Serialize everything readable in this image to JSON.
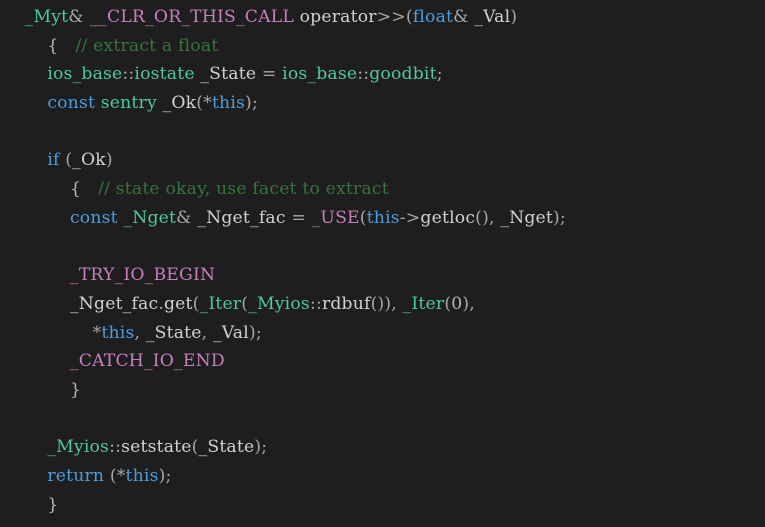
{
  "editor": {
    "background_color": "#1e1e1e",
    "language": "C++",
    "font_size_px": 17,
    "line_height_px": 28.7,
    "indent_unit": "    "
  },
  "palette": {
    "plain": "#cfcfcf",
    "punctuation": "#a8a8a8",
    "keyword": "#4a9ee0",
    "type": "#4ec9a0",
    "macro": "#c77fc0",
    "comment": "#37753a",
    "identifier": "#d2d2d2",
    "number": "#b6b6b6",
    "brace": "#b9b9a8"
  },
  "code": {
    "lines": [
      {
        "indent": "    ",
        "tokens": [
          {
            "text": "_Myt",
            "kind": "type"
          },
          {
            "text": "& ",
            "kind": "punct"
          },
          {
            "text": "__CLR_OR_THIS_CALL",
            "kind": "macro"
          },
          {
            "text": " ",
            "kind": "plain"
          },
          {
            "text": "operator",
            "kind": "ident"
          },
          {
            "text": ">>",
            "kind": "punct"
          },
          {
            "text": "(",
            "kind": "punct"
          },
          {
            "text": "float",
            "kind": "keyword"
          },
          {
            "text": "& ",
            "kind": "punct"
          },
          {
            "text": "_Val",
            "kind": "ident"
          },
          {
            "text": ")",
            "kind": "punct"
          }
        ]
      },
      {
        "indent": "        ",
        "tokens": [
          {
            "text": "{",
            "kind": "brace"
          },
          {
            "text": "   ",
            "kind": "plain"
          },
          {
            "text": "// extract a float",
            "kind": "comment"
          }
        ]
      },
      {
        "indent": "        ",
        "tokens": [
          {
            "text": "ios_base",
            "kind": "type"
          },
          {
            "text": "::",
            "kind": "punct"
          },
          {
            "text": "iostate",
            "kind": "type"
          },
          {
            "text": " ",
            "kind": "plain"
          },
          {
            "text": "_State",
            "kind": "ident"
          },
          {
            "text": " = ",
            "kind": "punct"
          },
          {
            "text": "ios_base",
            "kind": "type"
          },
          {
            "text": "::",
            "kind": "punct"
          },
          {
            "text": "goodbit",
            "kind": "type"
          },
          {
            "text": ";",
            "kind": "punct"
          }
        ]
      },
      {
        "indent": "        ",
        "tokens": [
          {
            "text": "const",
            "kind": "keyword"
          },
          {
            "text": " ",
            "kind": "plain"
          },
          {
            "text": "sentry",
            "kind": "type"
          },
          {
            "text": " ",
            "kind": "plain"
          },
          {
            "text": "_Ok",
            "kind": "ident"
          },
          {
            "text": "(",
            "kind": "punct"
          },
          {
            "text": "*",
            "kind": "punct"
          },
          {
            "text": "this",
            "kind": "keyword"
          },
          {
            "text": ");",
            "kind": "punct"
          }
        ]
      },
      {
        "indent": "",
        "tokens": []
      },
      {
        "indent": "        ",
        "tokens": [
          {
            "text": "if",
            "kind": "keyword"
          },
          {
            "text": " (",
            "kind": "punct"
          },
          {
            "text": "_Ok",
            "kind": "ident"
          },
          {
            "text": ")",
            "kind": "punct"
          }
        ]
      },
      {
        "indent": "            ",
        "tokens": [
          {
            "text": "{",
            "kind": "brace"
          },
          {
            "text": "   ",
            "kind": "plain"
          },
          {
            "text": "// state okay, use facet to extract",
            "kind": "comment"
          }
        ]
      },
      {
        "indent": "            ",
        "tokens": [
          {
            "text": "const",
            "kind": "keyword"
          },
          {
            "text": " ",
            "kind": "plain"
          },
          {
            "text": "_Nget",
            "kind": "type"
          },
          {
            "text": "& ",
            "kind": "punct"
          },
          {
            "text": "_Nget_fac",
            "kind": "ident"
          },
          {
            "text": " = ",
            "kind": "punct"
          },
          {
            "text": "_USE",
            "kind": "macro"
          },
          {
            "text": "(",
            "kind": "punct"
          },
          {
            "text": "this",
            "kind": "keyword"
          },
          {
            "text": "->",
            "kind": "punct"
          },
          {
            "text": "getloc",
            "kind": "ident"
          },
          {
            "text": "(), ",
            "kind": "punct"
          },
          {
            "text": "_Nget",
            "kind": "ident"
          },
          {
            "text": ");",
            "kind": "punct"
          }
        ]
      },
      {
        "indent": "",
        "tokens": []
      },
      {
        "indent": "            ",
        "tokens": [
          {
            "text": "_TRY_IO_BEGIN",
            "kind": "macro"
          }
        ]
      },
      {
        "indent": "            ",
        "tokens": [
          {
            "text": "_Nget_fac",
            "kind": "ident"
          },
          {
            "text": ".",
            "kind": "punct"
          },
          {
            "text": "get",
            "kind": "ident"
          },
          {
            "text": "(",
            "kind": "punct"
          },
          {
            "text": "_Iter",
            "kind": "type"
          },
          {
            "text": "(",
            "kind": "punct"
          },
          {
            "text": "_Myios",
            "kind": "type"
          },
          {
            "text": "::",
            "kind": "punct"
          },
          {
            "text": "rdbuf",
            "kind": "ident"
          },
          {
            "text": "()), ",
            "kind": "punct"
          },
          {
            "text": "_Iter",
            "kind": "type"
          },
          {
            "text": "(",
            "kind": "punct"
          },
          {
            "text": "0",
            "kind": "number"
          },
          {
            "text": "),",
            "kind": "punct"
          }
        ]
      },
      {
        "indent": "                ",
        "tokens": [
          {
            "text": "*",
            "kind": "punct"
          },
          {
            "text": "this",
            "kind": "keyword"
          },
          {
            "text": ", ",
            "kind": "punct"
          },
          {
            "text": "_State",
            "kind": "ident"
          },
          {
            "text": ", ",
            "kind": "punct"
          },
          {
            "text": "_Val",
            "kind": "ident"
          },
          {
            "text": ");",
            "kind": "punct"
          }
        ]
      },
      {
        "indent": "            ",
        "tokens": [
          {
            "text": "_CATCH_IO_END",
            "kind": "macro"
          }
        ]
      },
      {
        "indent": "            ",
        "tokens": [
          {
            "text": "}",
            "kind": "brace"
          }
        ]
      },
      {
        "indent": "",
        "tokens": []
      },
      {
        "indent": "        ",
        "tokens": [
          {
            "text": "_Myios",
            "kind": "type"
          },
          {
            "text": "::",
            "kind": "punct"
          },
          {
            "text": "setstate",
            "kind": "ident"
          },
          {
            "text": "(",
            "kind": "punct"
          },
          {
            "text": "_State",
            "kind": "ident"
          },
          {
            "text": ");",
            "kind": "punct"
          }
        ]
      },
      {
        "indent": "        ",
        "tokens": [
          {
            "text": "return",
            "kind": "keyword"
          },
          {
            "text": " (",
            "kind": "punct"
          },
          {
            "text": "*",
            "kind": "punct"
          },
          {
            "text": "this",
            "kind": "keyword"
          },
          {
            "text": ");",
            "kind": "punct"
          }
        ]
      },
      {
        "indent": "        ",
        "tokens": [
          {
            "text": "}",
            "kind": "brace"
          }
        ]
      }
    ]
  }
}
